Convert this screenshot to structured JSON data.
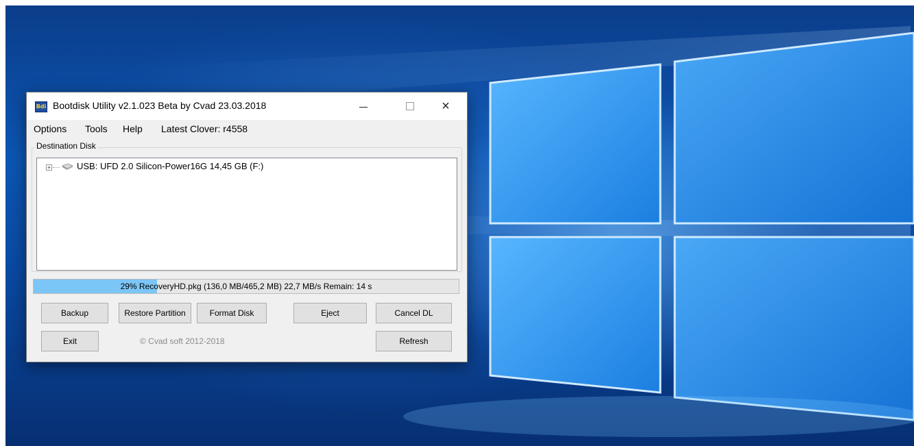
{
  "window": {
    "title": "Bootdisk Utility v2.1.023 Beta by Cvad 23.03.2018",
    "icon_label": "Bdi",
    "controls": {
      "minimize": "minimize-icon",
      "maximize": "maximize-icon",
      "close": "×"
    }
  },
  "menu": {
    "items": [
      "Options",
      "Tools",
      "Help",
      "Latest Clover: r4558"
    ]
  },
  "destination": {
    "label": "Destination Disk",
    "tree": [
      {
        "expander": "+",
        "label": "USB: UFD 2.0 Silicon-Power16G 14,45 GB (F:)",
        "icon": "usb-disk-icon"
      }
    ]
  },
  "progress": {
    "percent": 29,
    "text": "29% RecoveryHD.pkg (136,0 MB/465,2 MB) 22,7 MB/s Remain: 14 s",
    "fill_color": "#7cc6f7"
  },
  "buttons": {
    "backup": "Backup",
    "restore_partition": "Restore Partition",
    "format_disk": "Format Disk",
    "eject": "Eject",
    "cancel_dl": "Cancel DL",
    "exit": "Exit",
    "refresh": "Refresh"
  },
  "footer": {
    "copyright": "© Cvad soft 2012-2018"
  },
  "colors": {
    "accent": "#0c56b3",
    "progress": "#7cc6f7",
    "window_bg": "#f0f0f0"
  }
}
